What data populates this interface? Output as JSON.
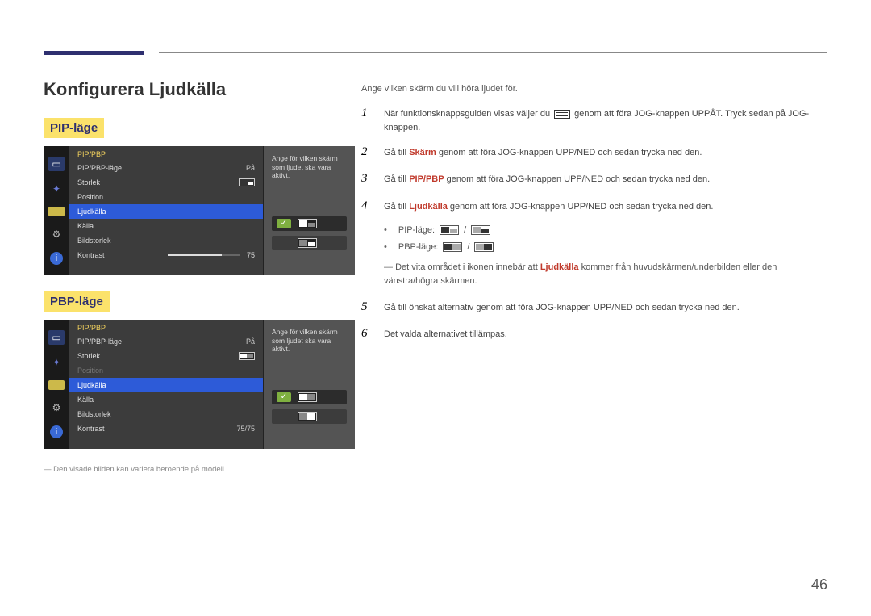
{
  "page": {
    "title": "Konfigurera Ljudkälla",
    "disclaimer": "Den visade bilden kan variera beroende på modell.",
    "number": "46"
  },
  "modes": {
    "pip": "PIP-läge",
    "pbp": "PBP-läge"
  },
  "osd": {
    "header": "PIP/PBP",
    "items": {
      "mode": "PIP/PBP-läge",
      "mode_val": "På",
      "storlek": "Storlek",
      "position": "Position",
      "ljudkalla": "Ljudkälla",
      "kalla": "Källa",
      "bildstorlek": "Bildstorlek",
      "kontrast": "Kontrast",
      "kontrast_val_pip": "75",
      "kontrast_val_pbp": "75/75"
    },
    "preview_help": "Ange för vilken skärm som ljudet ska vara aktivt."
  },
  "guide": {
    "intro": "Ange vilken skärm du vill höra ljudet för.",
    "steps": {
      "s1a": "När funktionsknappsguiden visas väljer du ",
      "s1b": " genom att föra JOG-knappen UPPÅT. Tryck sedan på JOG-knappen.",
      "s2a": "Gå till ",
      "s2b": "Skärm",
      "s2c": " genom att föra JOG-knappen UPP/NED och sedan trycka ned den.",
      "s3a": "Gå till ",
      "s3b": "PIP/PBP",
      "s3c": " genom att föra JOG-knappen UPP/NED och sedan trycka ned den.",
      "s4a": "Gå till ",
      "s4b": "Ljudkälla",
      "s4c": " genom att föra JOG-knappen UPP/NED och sedan trycka ned den.",
      "pip_label": "PIP-läge:",
      "pbp_label": "PBP-läge:",
      "note_a": "Det vita området i ikonen innebär att ",
      "note_b": "Ljudkälla",
      "note_c": " kommer från huvudskärmen/underbilden eller den vänstra/högra skärmen.",
      "s5": "Gå till önskat alternativ genom att föra JOG-knappen UPP/NED och sedan trycka ned den.",
      "s6": "Det valda alternativet tillämpas."
    }
  }
}
